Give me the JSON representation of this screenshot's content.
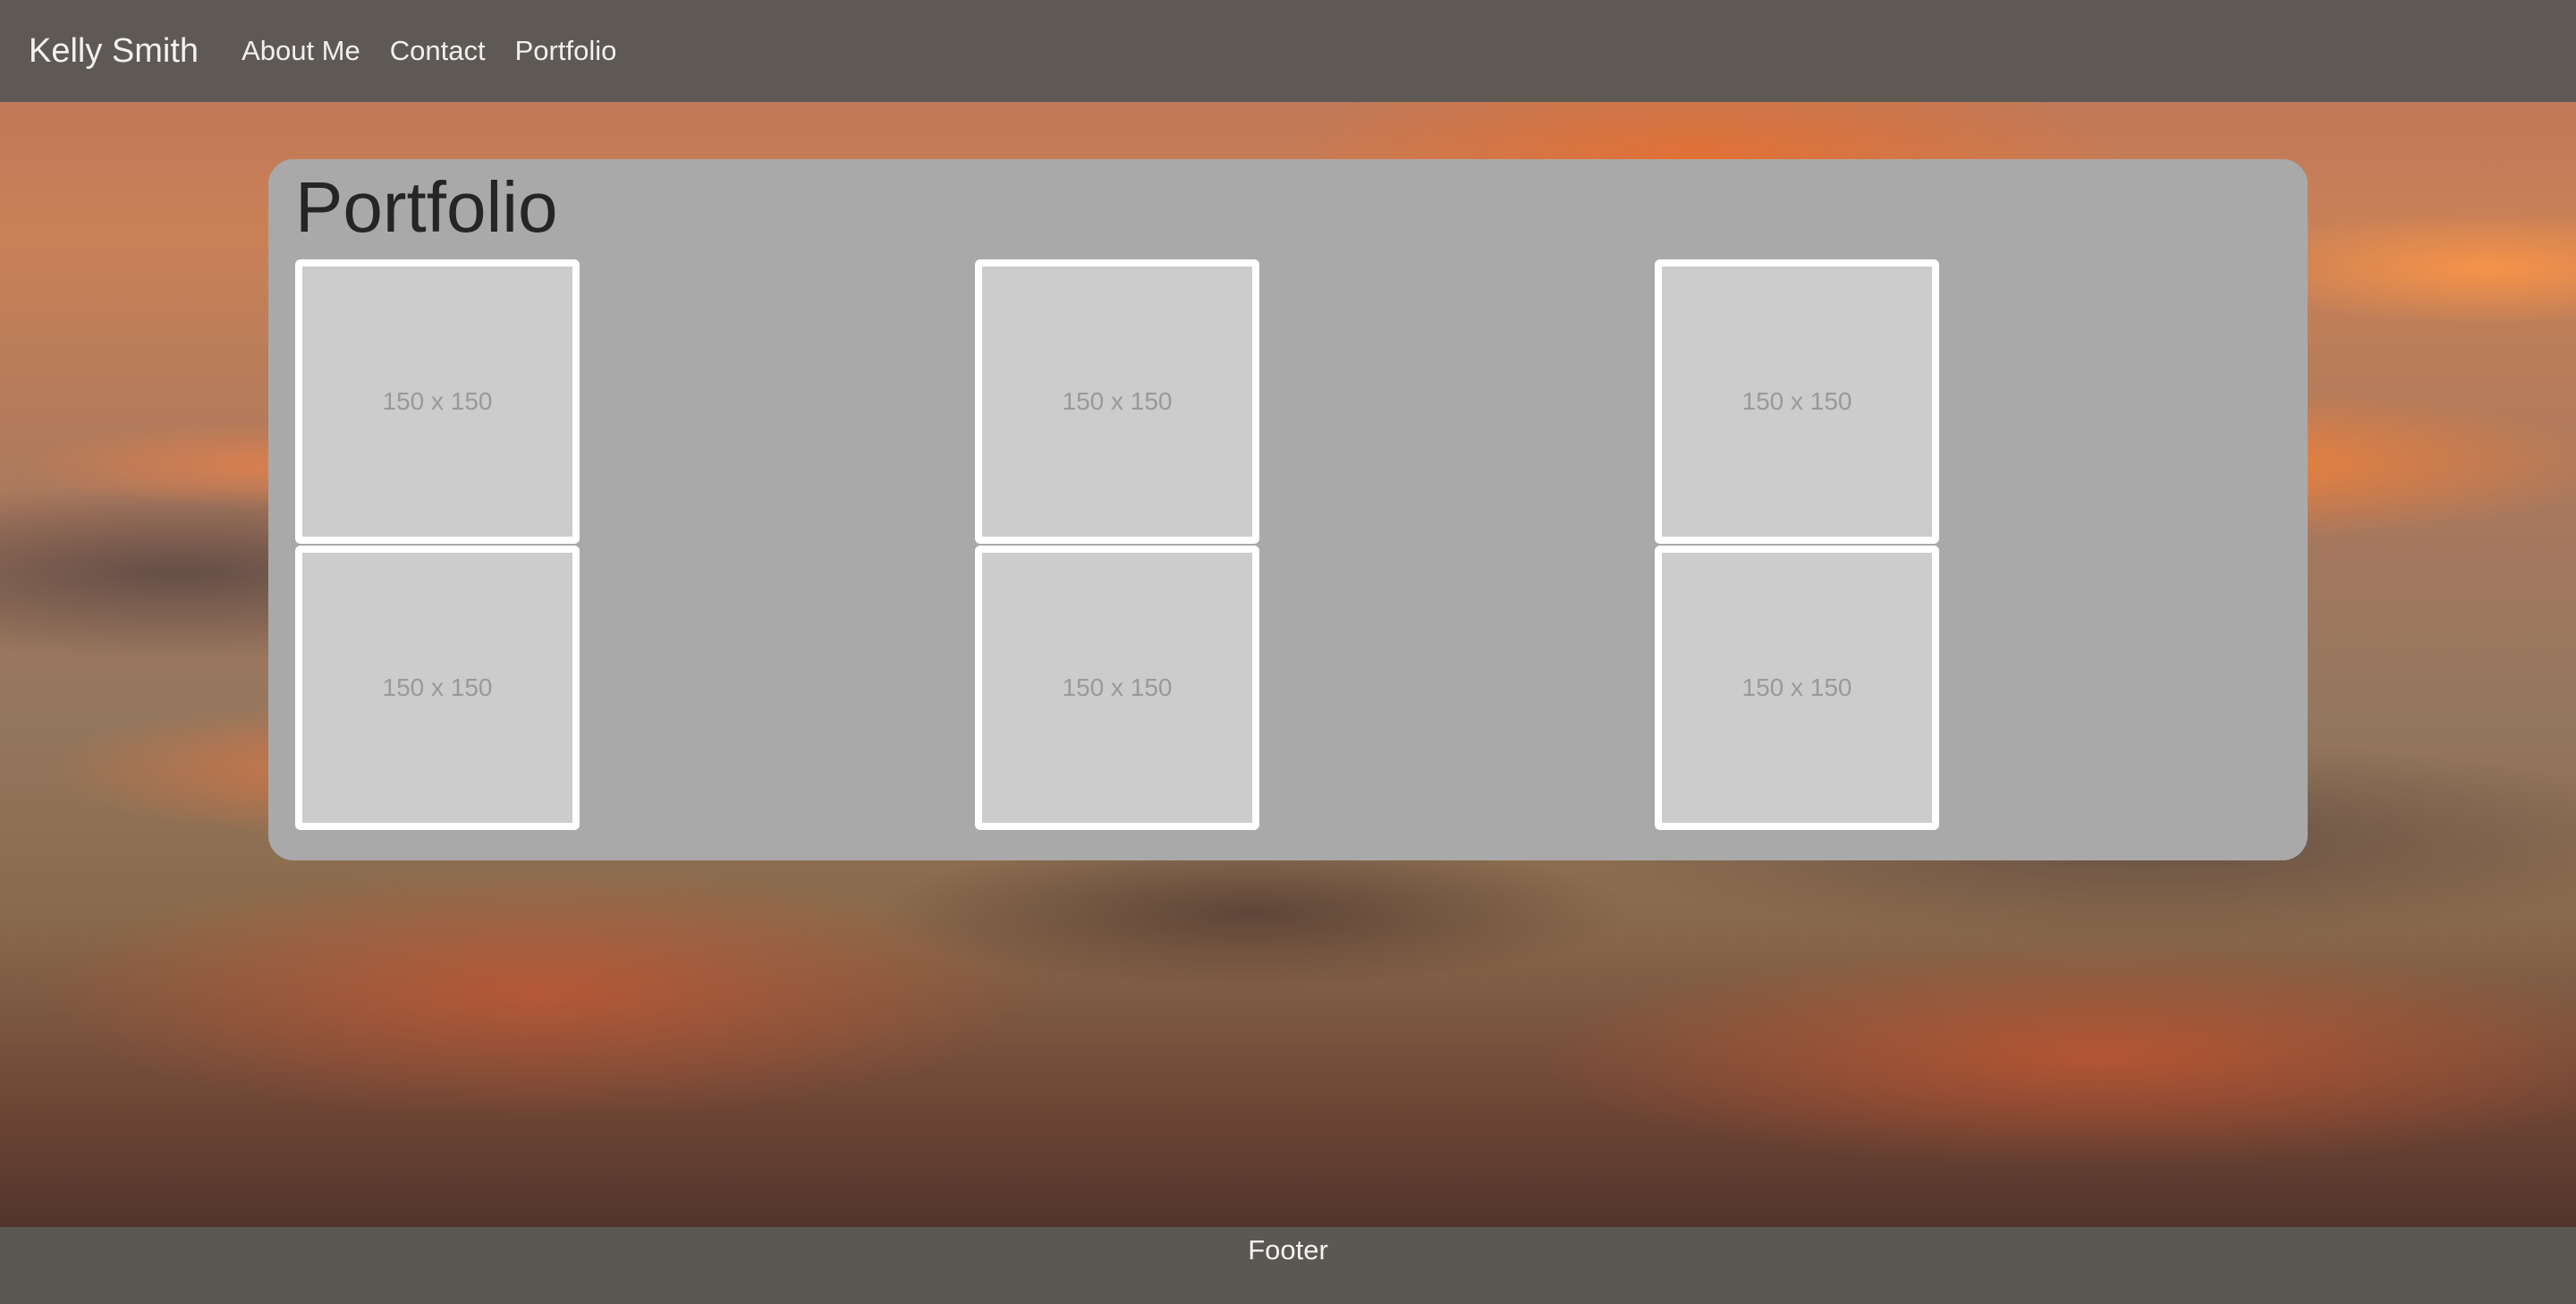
{
  "navbar": {
    "brand": "Kelly Smith",
    "links": [
      "About Me",
      "Contact",
      "Portfolio"
    ]
  },
  "main": {
    "title": "Portfolio",
    "thumbnails": [
      {
        "label": "150 x 150"
      },
      {
        "label": "150 x 150"
      },
      {
        "label": "150 x 150"
      },
      {
        "label": "150 x 150"
      },
      {
        "label": "150 x 150"
      },
      {
        "label": "150 x 150"
      }
    ]
  },
  "footer": {
    "text": "Footer"
  },
  "colors": {
    "navbar": "#5c5954",
    "panel": "#a9a9a9",
    "placeholder": "#cccccc",
    "placeholder_text": "#999999",
    "title": "#232527"
  }
}
